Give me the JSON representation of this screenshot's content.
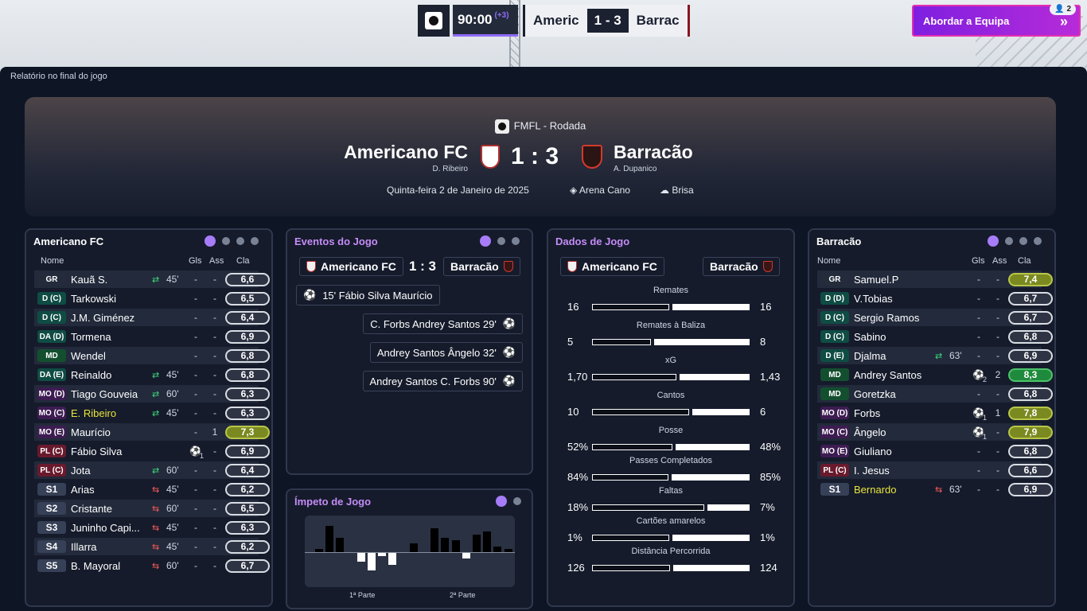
{
  "topbar": {
    "time": "90:00",
    "added": "(+3)",
    "home_short": "Americ",
    "score": "1 - 3",
    "away_short": "Barrac",
    "team_button": "Abordar a Equipa",
    "notification_count": "2"
  },
  "report_title": "Relatório no final do jogo",
  "header": {
    "competition": "FMFL - Rodada",
    "home_team": "Americano FC",
    "home_coach": "D. Ribeiro",
    "away_team": "Barracão",
    "away_coach": "A. Dupanico",
    "score": "1 : 3",
    "date": "Quinta-feira 2 de Janeiro de 2025",
    "venue": "Arena Cano",
    "weather": "Brisa"
  },
  "home_panel": {
    "title": "Americano FC",
    "cols": {
      "name": "Nome",
      "gls": "Gls",
      "ass": "Ass",
      "cla": "Cla"
    },
    "players": [
      {
        "pos": "GR",
        "name": "Kauã S.",
        "sub": "in",
        "min": "45'",
        "gls": "-",
        "ass": "-",
        "rating": "6,6"
      },
      {
        "pos": "D (C)",
        "name": "Tarkowski",
        "gls": "-",
        "ass": "-",
        "rating": "6,5"
      },
      {
        "pos": "D (C)",
        "name": "J.M. Giménez",
        "gls": "-",
        "ass": "-",
        "rating": "6,4"
      },
      {
        "pos": "DA (D)",
        "name": "Tormena",
        "gls": "-",
        "ass": "-",
        "rating": "6,9"
      },
      {
        "pos": "MD",
        "name": "Wendel",
        "gls": "-",
        "ass": "-",
        "rating": "6,8"
      },
      {
        "pos": "DA (E)",
        "name": "Reinaldo",
        "sub": "in",
        "min": "45'",
        "gls": "-",
        "ass": "-",
        "rating": "6,8"
      },
      {
        "pos": "MO (D)",
        "name": "Tiago Gouveia",
        "sub": "in",
        "min": "60'",
        "gls": "-",
        "ass": "-",
        "rating": "6,3"
      },
      {
        "pos": "MO (C)",
        "name": "E. Ribeiro",
        "sub": "in",
        "min": "45'",
        "gls": "-",
        "ass": "-",
        "rating": "6,3"
      },
      {
        "pos": "MO (E)",
        "name": "Maurício",
        "gls": "-",
        "ass": "1",
        "rating": "7,3"
      },
      {
        "pos": "PL (C)",
        "name": "Fábio Silva",
        "goal": "1",
        "ass": "-",
        "rating": "6,9"
      },
      {
        "pos": "PL (C)",
        "name": "Jota",
        "sub": "in",
        "min": "60'",
        "gls": "-",
        "ass": "-",
        "rating": "6,4"
      },
      {
        "pos": "S1",
        "name": "Arias",
        "sub": "out",
        "min": "45'",
        "gls": "-",
        "ass": "-",
        "rating": "6,2"
      },
      {
        "pos": "S2",
        "name": "Cristante",
        "sub": "out",
        "min": "60'",
        "gls": "-",
        "ass": "-",
        "rating": "6,5"
      },
      {
        "pos": "S3",
        "name": "Juninho Capi...",
        "sub": "out",
        "min": "45'",
        "gls": "-",
        "ass": "-",
        "rating": "6,3"
      },
      {
        "pos": "S4",
        "name": "Illarra",
        "sub": "out",
        "min": "45'",
        "gls": "-",
        "ass": "-",
        "rating": "6,2"
      },
      {
        "pos": "S5",
        "name": "B. Mayoral",
        "sub": "out",
        "min": "60'",
        "gls": "-",
        "ass": "-",
        "rating": "6,7"
      }
    ]
  },
  "events_panel": {
    "title": "Eventos do Jogo",
    "home": "Americano FC",
    "score": "1 : 3",
    "away": "Barracão",
    "events": [
      {
        "side": "home",
        "text": "15'  Fábio Silva  Maurício"
      },
      {
        "side": "away",
        "text": "C. Forbs  Andrey Santos  29'"
      },
      {
        "side": "away",
        "text": "Andrey Santos  Ângelo  32'"
      },
      {
        "side": "away",
        "text": "Andrey Santos  C. Forbs  90'"
      }
    ]
  },
  "momentum_panel": {
    "title": "Ímpeto de Jogo",
    "first_half": "1ª Parte",
    "second_half": "2ª Parte",
    "values": [
      1,
      9,
      5,
      0,
      -3,
      -6,
      -1,
      -4,
      0,
      3,
      0,
      8,
      5,
      4,
      -2,
      6,
      7,
      2,
      1
    ]
  },
  "stats_panel": {
    "title": "Dados de Jogo",
    "home": "Americano FC",
    "away": "Barracão",
    "stats": [
      {
        "label": "Remates",
        "home": "16",
        "away": "16",
        "hv": 16,
        "av": 16
      },
      {
        "label": "Remates à Baliza",
        "home": "5",
        "away": "8",
        "hv": 5,
        "av": 8
      },
      {
        "label": "xG",
        "home": "1,70",
        "away": "1,43",
        "hv": 1.7,
        "av": 1.43
      },
      {
        "label": "Cantos",
        "home": "10",
        "away": "6",
        "hv": 10,
        "av": 6
      },
      {
        "label": "Posse",
        "home": "52%",
        "away": "48%",
        "hv": 52,
        "av": 48
      },
      {
        "label": "Passes Completados",
        "home": "84%",
        "away": "85%",
        "hv": 84,
        "av": 85
      },
      {
        "label": "Faltas",
        "home": "18%",
        "away": "7%",
        "hv": 18,
        "av": 7
      },
      {
        "label": "Cartões amarelos",
        "home": "1%",
        "away": "1%",
        "hv": 1,
        "av": 1
      },
      {
        "label": "Distância Percorrida",
        "home": "126",
        "away": "124",
        "hv": 126,
        "av": 124
      }
    ]
  },
  "away_panel": {
    "title": "Barracão",
    "cols": {
      "name": "Nome",
      "gls": "Gls",
      "ass": "Ass",
      "cla": "Cla"
    },
    "players": [
      {
        "pos": "GR",
        "name": "Samuel.P",
        "gls": "-",
        "ass": "-",
        "rating": "7,4"
      },
      {
        "pos": "D (D)",
        "name": "V.Tobias",
        "gls": "-",
        "ass": "-",
        "rating": "6,7"
      },
      {
        "pos": "D (C)",
        "name": "Sergio Ramos",
        "gls": "-",
        "ass": "-",
        "rating": "6,7"
      },
      {
        "pos": "D (C)",
        "name": "Sabino",
        "gls": "-",
        "ass": "-",
        "rating": "6,8"
      },
      {
        "pos": "D (E)",
        "name": "Djalma",
        "sub": "in",
        "min": "63'",
        "gls": "-",
        "ass": "-",
        "rating": "6,9"
      },
      {
        "pos": "MD",
        "name": "Andrey Santos",
        "goal": "2",
        "ass": "2",
        "rating": "8,3"
      },
      {
        "pos": "MD",
        "name": "Goretzka",
        "gls": "-",
        "ass": "-",
        "rating": "6,8"
      },
      {
        "pos": "MO (D)",
        "name": "Forbs",
        "goal": "1",
        "ass": "1",
        "rating": "7,8"
      },
      {
        "pos": "MO (C)",
        "name": "Ângelo",
        "goal": "1",
        "ass": "-",
        "rating": "7,9"
      },
      {
        "pos": "MO (E)",
        "name": "Giuliano",
        "gls": "-",
        "ass": "-",
        "rating": "6,8"
      },
      {
        "pos": "PL (C)",
        "name": "I. Jesus",
        "gls": "-",
        "ass": "-",
        "rating": "6,6"
      },
      {
        "pos": "S1",
        "name": "Bernardo",
        "sub": "out",
        "min": "63'",
        "gls": "-",
        "ass": "-",
        "rating": "6,9"
      }
    ]
  },
  "colors": {
    "accent": "#a77cf8",
    "title_purple": "#c58cf6",
    "sub_in": "#3fd97d",
    "sub_out": "#ff5b5b"
  }
}
